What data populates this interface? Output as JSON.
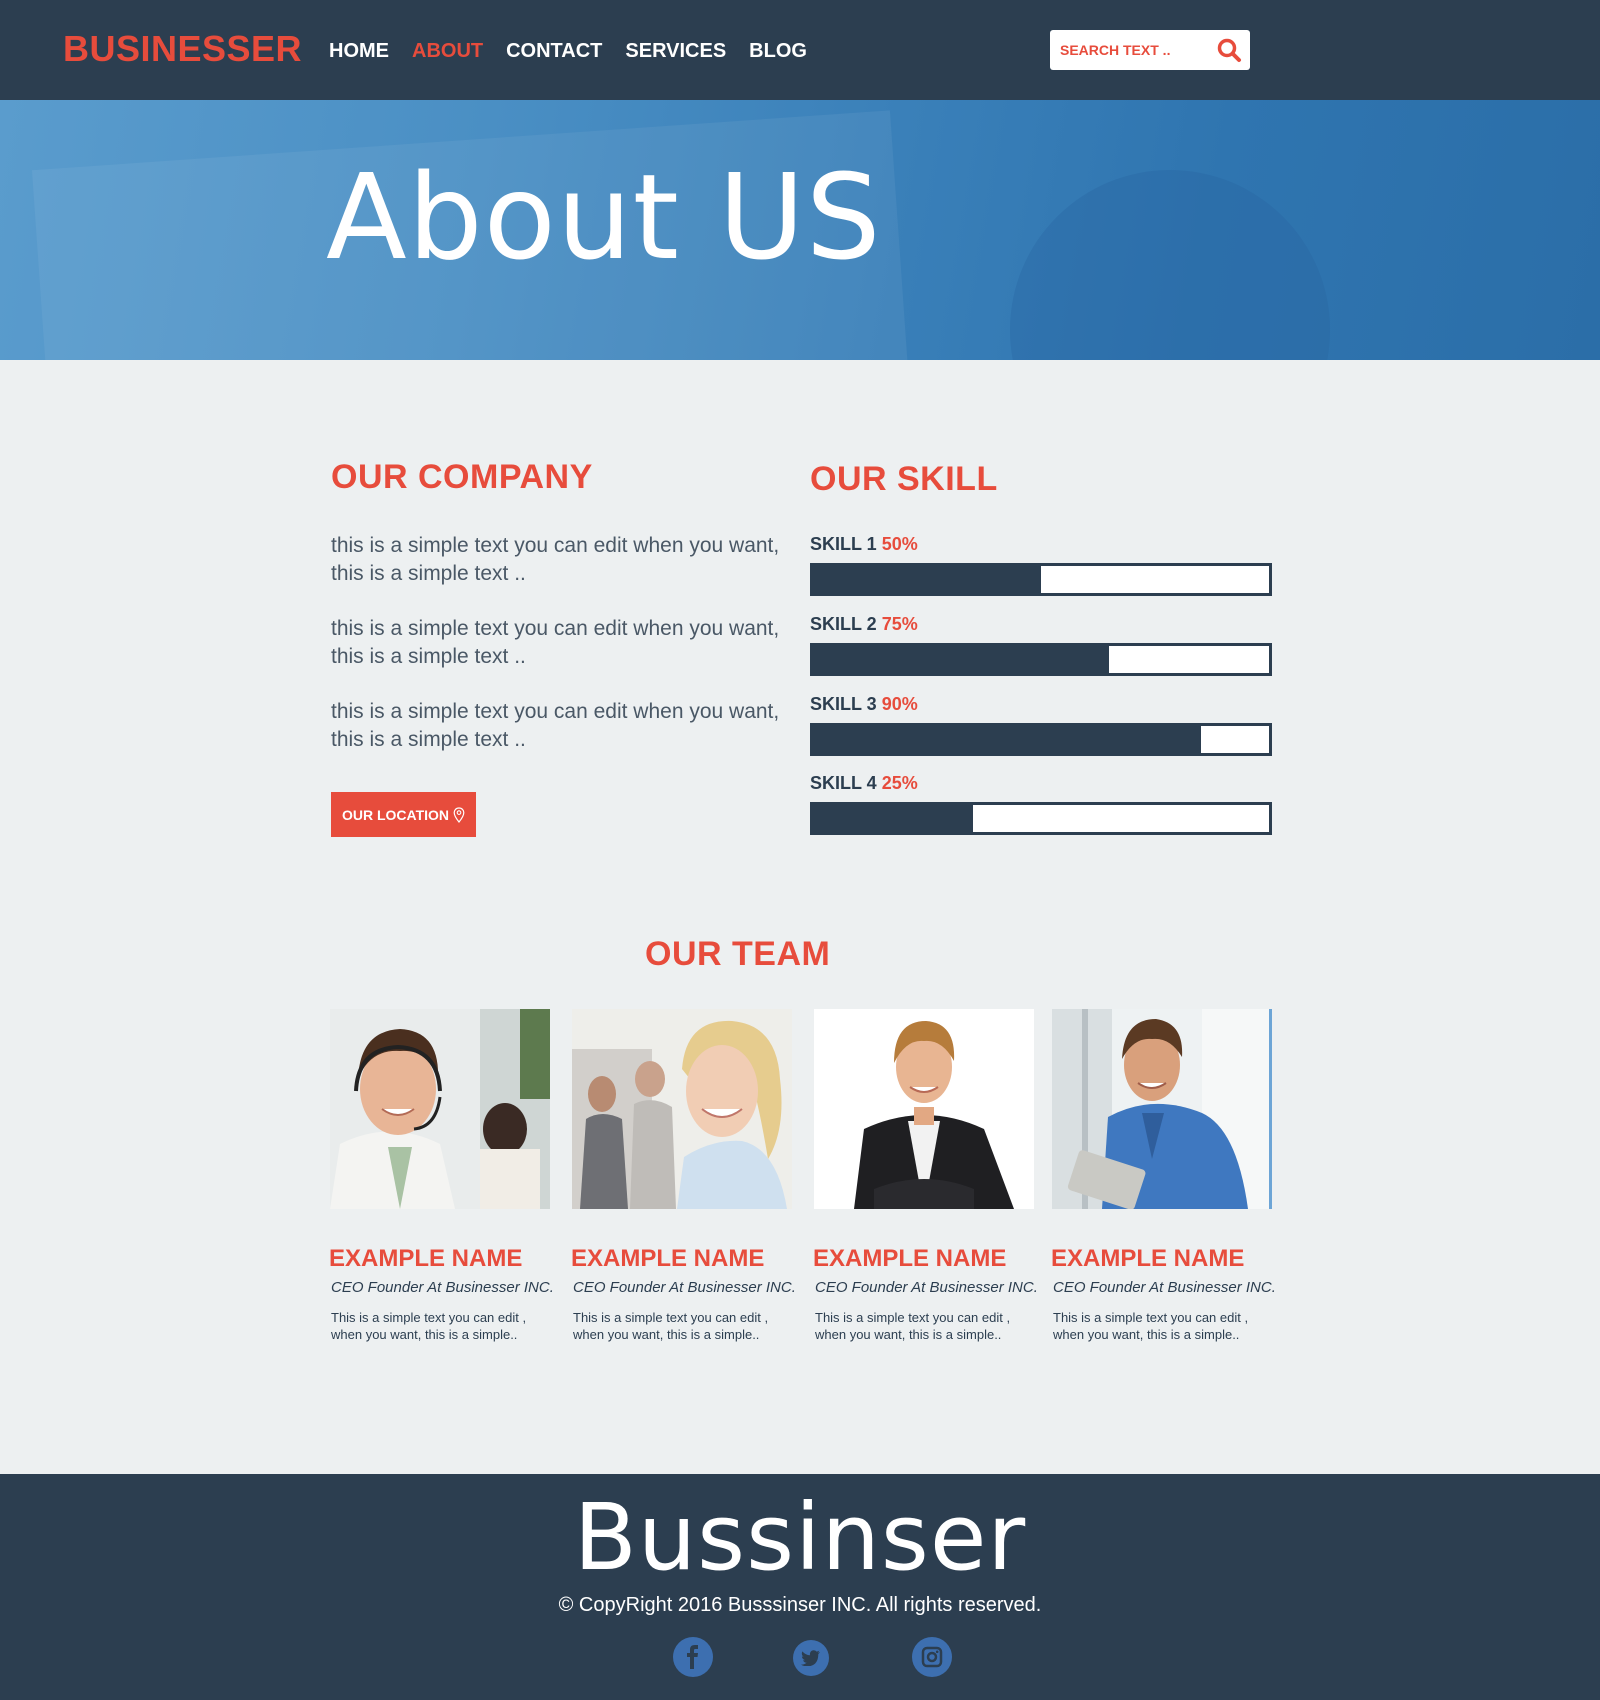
{
  "header": {
    "logo": "BUSINESSER",
    "nav": [
      {
        "label": "HOME",
        "active": false
      },
      {
        "label": "ABOUT",
        "active": true
      },
      {
        "label": "CONTACT",
        "active": false
      },
      {
        "label": "SERVICES",
        "active": false
      },
      {
        "label": "BLOG",
        "active": false
      }
    ],
    "search": {
      "placeholder": "SEARCH TEXT ..",
      "icon": "search-icon"
    }
  },
  "hero": {
    "title": "About US"
  },
  "company": {
    "title": "OUR COMPANY",
    "paragraphs": [
      "this is a simple text you can edit when you want, this is a simple text ..",
      "this is a simple text you can edit when you want, this is a simple text ..",
      "this is a simple text you can edit when you want, this is a simple text .."
    ],
    "location_button": "OUR LOCATION",
    "location_icon": "map-pin-icon"
  },
  "skills": {
    "title": "OUR SKILL",
    "items": [
      {
        "label": "SKILL 1",
        "percent_text": "50%",
        "value": 0.5
      },
      {
        "label": "SKILL 2",
        "percent_text": "75%",
        "value": 0.65
      },
      {
        "label": "SKILL 3",
        "percent_text": "90%",
        "value": 0.85
      },
      {
        "label": "SKILL 4",
        "percent_text": "25%",
        "value": 0.35
      }
    ]
  },
  "team": {
    "title": "OUR TEAM",
    "members": [
      {
        "name": "EXAMPLE NAME",
        "role": "CEO Founder At Businesser INC.",
        "description": "This is a simple text you can edit , when you want, this is a simple.."
      },
      {
        "name": "EXAMPLE NAME",
        "role": "CEO Founder At Businesser INC.",
        "description": "This is a simple text you can edit , when you want, this is a simple.."
      },
      {
        "name": "EXAMPLE NAME",
        "role": "CEO Founder At Businesser INC.",
        "description": "This is a simple text you can edit , when you want, this is a simple.."
      },
      {
        "name": "EXAMPLE NAME",
        "role": "CEO Founder At Businesser INC.",
        "description": "This is a simple text you can edit , when you want, this is a simple.."
      }
    ]
  },
  "footer": {
    "brand": "Bussinser",
    "copyright": "© CopyRight 2016 Busssinser INC. All rights reserved.",
    "social": [
      "facebook-icon",
      "twitter-icon",
      "instagram-icon"
    ]
  },
  "colors": {
    "accent": "#e74c3c",
    "dark": "#2c3e50",
    "background": "#edf0f1",
    "social": "#3d6fb0"
  }
}
